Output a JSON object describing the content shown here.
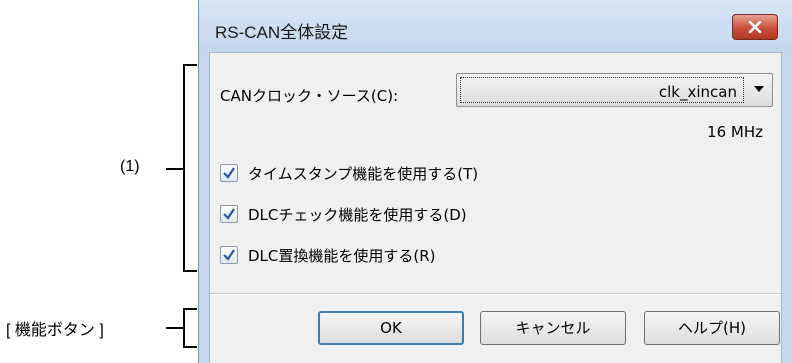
{
  "dialog": {
    "title": "RS-CAN全体設定",
    "close_icon": "close-icon"
  },
  "clock": {
    "label": "CANクロック・ソース(C):",
    "selected": "clk_xincan",
    "frequency": "16 MHz"
  },
  "checks": [
    {
      "label": "タイムスタンプ機能を使用する(T)",
      "checked": true
    },
    {
      "label": "DLCチェック機能を使用する(D)",
      "checked": true
    },
    {
      "label": "DLC置換機能を使用する(R)",
      "checked": true
    }
  ],
  "buttons": {
    "ok": "OK",
    "cancel": "キャンセル",
    "help": "ヘルプ(H)"
  },
  "annotations": {
    "group1": "(1)",
    "buttons": "[ 機能ボタン ]"
  },
  "colors": {
    "title_bg": "#c4d7ee",
    "close_bg": "#c8513c",
    "check_mark": "#2a55a8",
    "default_border": "#3c7fb1"
  }
}
